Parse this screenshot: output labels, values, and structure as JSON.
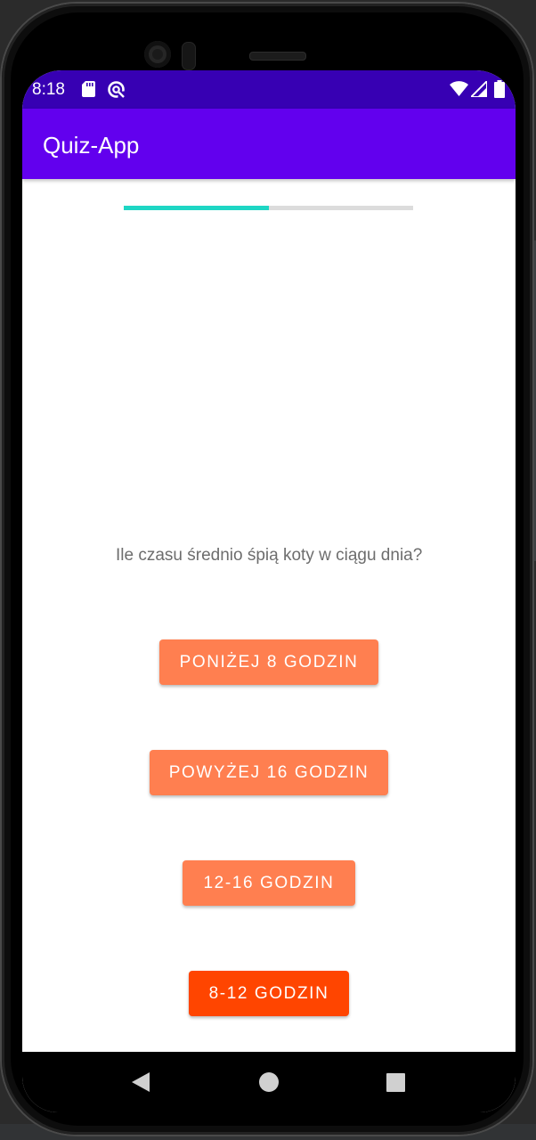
{
  "status_bar": {
    "time": "8:18",
    "icons": [
      "sd-card-icon",
      "sync-icon",
      "wifi-icon",
      "signal-icon",
      "battery-icon"
    ]
  },
  "app_bar": {
    "title": "Quiz-App"
  },
  "quiz": {
    "progress": 0.5,
    "question": "Ile czasu średnio śpią koty w ciągu dnia?",
    "answers": [
      {
        "label": "Poniżej 8 godzin",
        "selected": false
      },
      {
        "label": "Powyżej 16 godzin",
        "selected": false
      },
      {
        "label": "12-16 godzin",
        "selected": false
      },
      {
        "label": "8-12 godzin",
        "selected": true
      }
    ]
  },
  "nav_bar": {
    "buttons": [
      "back-icon",
      "home-icon",
      "recents-icon"
    ]
  },
  "colors": {
    "status_bar": "#3700b3",
    "app_bar": "#6200ee",
    "progress": "#1ed6c4",
    "answer_normal": "#ff7f50",
    "answer_selected": "#ff4500"
  }
}
